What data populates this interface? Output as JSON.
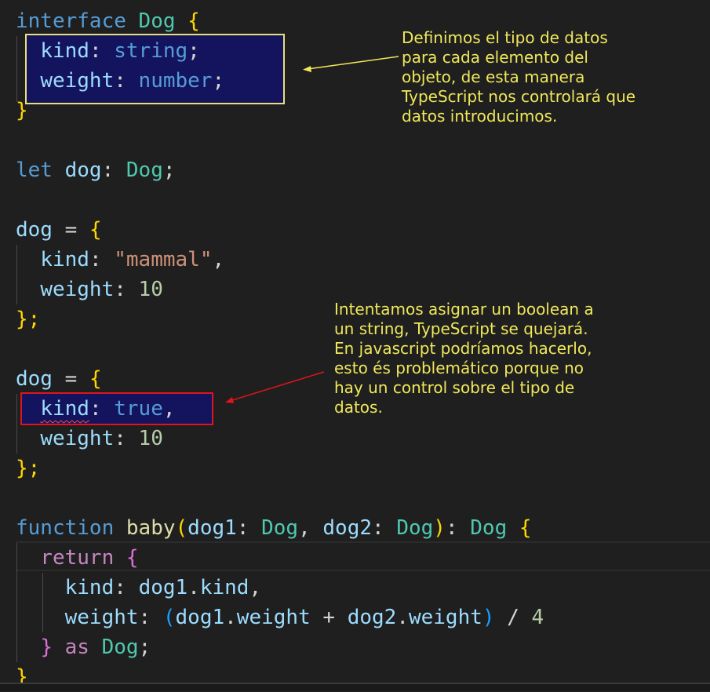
{
  "code": {
    "l1": {
      "kw": "interface",
      "name": "Dog",
      "open": "{"
    },
    "l2": {
      "prop": "kind",
      "colon": ":",
      "type": "string",
      "semi": ";"
    },
    "l3": {
      "prop": "weight",
      "colon": ":",
      "type": "number",
      "semi": ";"
    },
    "l4": {
      "close": "}"
    },
    "l5": {
      "kw": "let",
      "var": "dog",
      "colon": ":",
      "type": "Dog",
      "semi": ";"
    },
    "l6": {
      "var": "dog",
      "eq": "=",
      "open": "{"
    },
    "l7": {
      "prop": "kind",
      "colon": ":",
      "value": "\"mammal\"",
      "comma": ","
    },
    "l8": {
      "prop": "weight",
      "colon": ":",
      "value": "10"
    },
    "l9": {
      "close": "};"
    },
    "l10": {
      "var": "dog",
      "eq": "=",
      "open": "{"
    },
    "l11": {
      "prop": "kind",
      "colon": ":",
      "value": "true",
      "comma": ","
    },
    "l12": {
      "prop": "weight",
      "colon": ":",
      "value": "10"
    },
    "l13": {
      "close": "};"
    },
    "l14": {
      "kw": "function",
      "fn": "baby",
      "paren_open": "(",
      "p1": "dog1",
      "c1": ":",
      "t1": "Dog",
      "comma": ",",
      "p2": "dog2",
      "c2": ":",
      "t2": "Dog",
      "paren_close": ")",
      "c3": ":",
      "ret": "Dog",
      "open": "{"
    },
    "l15": {
      "kw": "return",
      "open": "{"
    },
    "l16": {
      "prop": "kind",
      "colon": ":",
      "obj": "dog1",
      "dot": ".",
      "member": "kind",
      "comma": ","
    },
    "l17": {
      "prop": "weight",
      "colon": ":",
      "po": "(",
      "a": "dog1",
      "d1": ".",
      "am": "weight",
      "plus": "+",
      "b": "dog2",
      "d2": ".",
      "bm": "weight",
      "pc": ")",
      "div": "/",
      "num": "4"
    },
    "l18": {
      "close": "}",
      "as": "as",
      "type": "Dog",
      "semi": ";"
    },
    "l19": {
      "close": "}"
    }
  },
  "annotations": {
    "top_note": "Definimos el tipo de datos\npara cada elemento del\nobjeto, de esta manera\nTypeScript nos controlará que\ndatos introducimos.",
    "error_note": "Intentamos asignar un boolean a\nun string, TypeScript se quejará.\nEn javascript podríamos hacerlo,\nesto és problemático porque no\nhay un control sobre el tipo de\ndatos."
  },
  "colors": {
    "background": "#1f1f1f",
    "keyword": "#569cd6",
    "type": "#4ec9b0",
    "variable": "#9cdcfe",
    "string": "#ce9178",
    "number": "#b5cea8",
    "function": "#dcdcaa",
    "annotation_text": "#f0e85a",
    "highlight_box_yellow": "#e8e07a",
    "highlight_box_red": "#e0141e",
    "error_squiggle": "#f14c4c"
  }
}
